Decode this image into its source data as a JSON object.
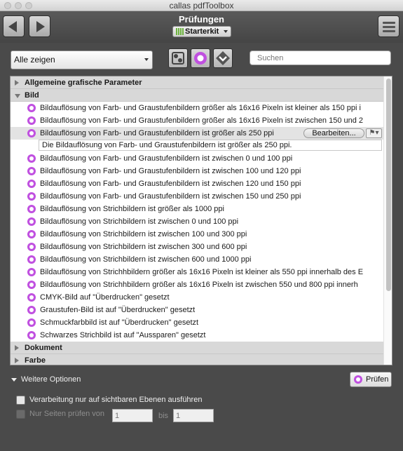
{
  "window": {
    "title": "callas pdfToolbox"
  },
  "header": {
    "title": "Prüfungen",
    "profile": "Starterkit",
    "profile_bar_color": "#6db33f"
  },
  "toolbar": {
    "back_icon": "back-arrow-icon",
    "forward_icon": "forward-arrow-icon",
    "menu_icon": "hamburger-menu-icon"
  },
  "filter": {
    "show_value": "Alle zeigen",
    "search_placeholder": "Suchen",
    "buttons": [
      "fixup-icon",
      "check-icon",
      "profile-icon"
    ]
  },
  "accent_color": "#c050e0",
  "list": {
    "groups": [
      {
        "label": "Allgemeine grafische Parameter",
        "expanded": false
      },
      {
        "label": "Bild",
        "expanded": true
      },
      {
        "label": "Dokument",
        "expanded": false
      },
      {
        "label": "Farbe",
        "expanded": false
      }
    ],
    "items": [
      "Bildauflösung von Farb- und Graustufenbildern größer als 16x16 Pixeln ist kleiner als 150 ppi i",
      "Bildauflösung von Farb- und Graustufenbildern größer als 16x16 Pixeln ist zwischen 150 und 2",
      "Bildauflösung von Farb- und Graustufenbildern ist größer als 250 ppi",
      "Bildauflösung von Farb- und Graustufenbildern ist zwischen 0 und 100 ppi",
      "Bildauflösung von Farb- und Graustufenbildern ist zwischen 100 und 120 ppi",
      "Bildauflösung von Farb- und Graustufenbildern ist zwischen 120 und 150 ppi",
      "Bildauflösung von Farb- und Graustufenbildern ist zwischen 150 und 250 ppi",
      "Bildauflösung von Strichbildern ist größer als 1000 ppi",
      "Bildauflösung von Strichbildern ist zwischen 0 und 100 ppi",
      "Bildauflösung von Strichbildern ist zwischen 100 und 300 ppi",
      "Bildauflösung von Strichbildern ist zwischen 300 und 600 ppi",
      "Bildauflösung von Strichbildern ist zwischen 600 und 1000 ppi",
      "Bildauflösung von Strichhbildern größer als 16x16 Pixeln ist kleiner als 550 ppi innerhalb des E",
      "Bildauflösung von Strichhbildern größer als 16x16 Pixeln ist zwischen 550 und 800 ppi innerh",
      "CMYK-Bild auf \"Überdrucken\" gesetzt",
      "Graustufen-Bild ist auf \"Überdrucken\" gesetzt",
      "Schmuckfarbbild ist auf \"Überdrucken\" gesetzt",
      "Schwarzes Strichbild ist auf \"Aussparen\" gesetzt"
    ],
    "selected": {
      "edit_label": "Bearbeiten...",
      "description": "Die Bildauflösung von Farb- und Graustufenbildern ist größer als 250 ppi."
    }
  },
  "footer": {
    "options_label": "Weitere Optionen",
    "run_label": "Prüfen",
    "visible_layers_label": "Verarbeitung nur auf sichtbaren Ebenen ausführen",
    "pages_label": "Nur Seiten prüfen von",
    "pages_to_label": "bis",
    "page_from_placeholder": "1",
    "page_to_placeholder": "1"
  }
}
